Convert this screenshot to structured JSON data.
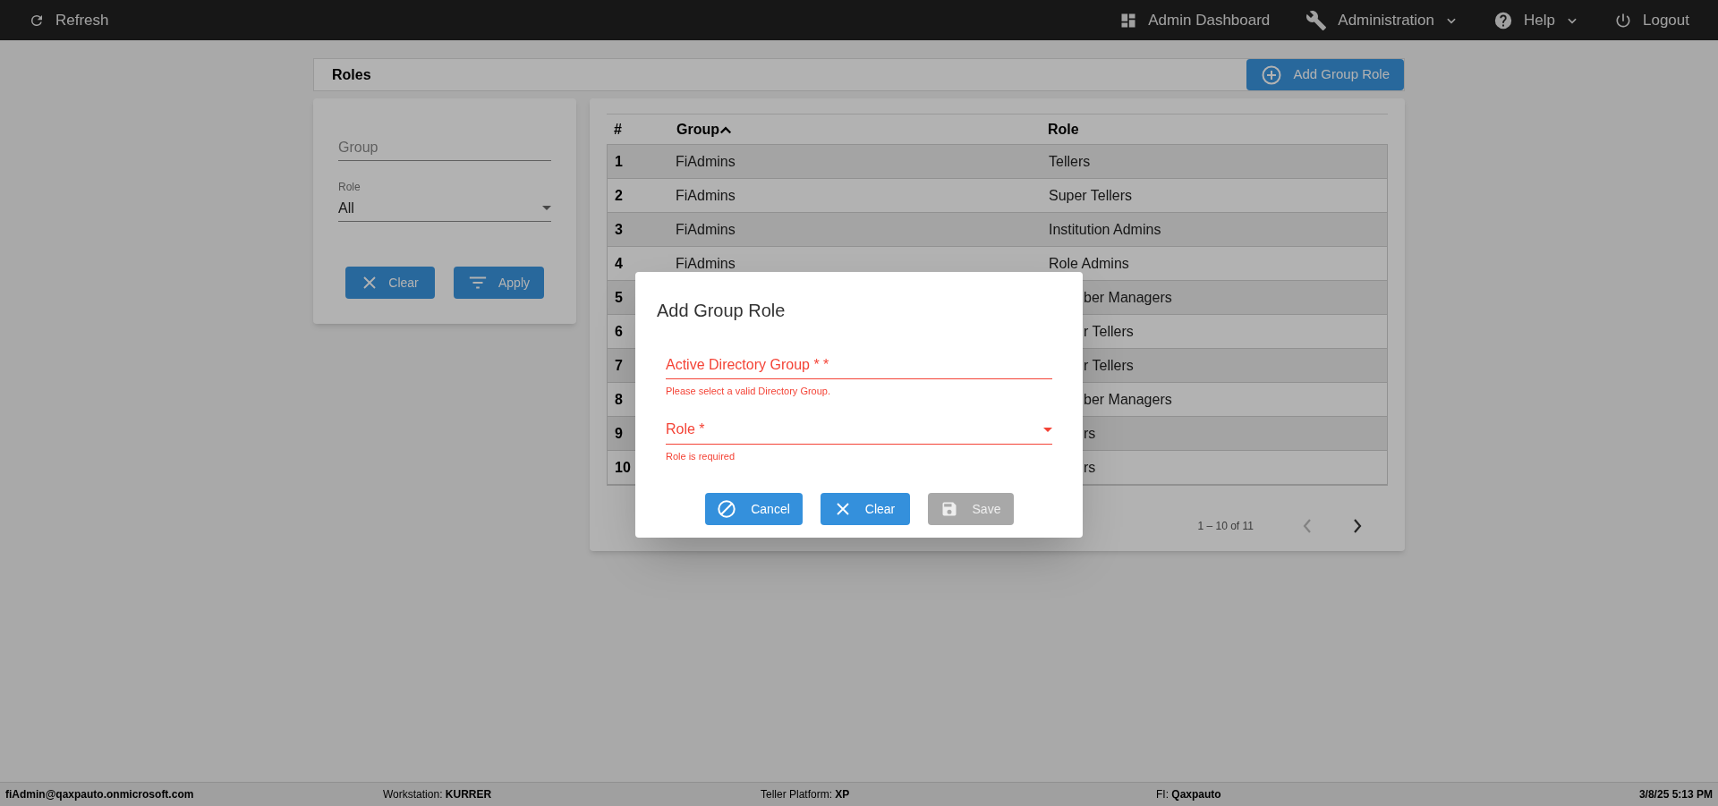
{
  "top_bar": {
    "left": [
      {
        "label": "Refresh"
      }
    ],
    "right": [
      {
        "label": "Admin Dashboard",
        "dropdown": false
      },
      {
        "label": "Administration",
        "dropdown": true
      },
      {
        "label": "Help",
        "dropdown": true
      },
      {
        "label": "Logout",
        "dropdown": false
      }
    ]
  },
  "page": {
    "title": "Roles",
    "add_button": "Add Group Role"
  },
  "filters": {
    "group_placeholder": "Group",
    "role_label": "Role",
    "role_value": "All",
    "buttons": [
      {
        "kind": "clear",
        "label": "Clear"
      },
      {
        "kind": "filter",
        "label": "Apply"
      }
    ]
  },
  "table": {
    "columns": [
      {
        "label": "#",
        "sorted": false
      },
      {
        "label": "Group",
        "sorted": true
      },
      {
        "label": "Role",
        "sorted": false
      }
    ],
    "rows": [
      {
        "number": "1",
        "group": "FiAdmins",
        "role": "Tellers"
      },
      {
        "number": "2",
        "group": "FiAdmins",
        "role": "Super Tellers"
      },
      {
        "number": "3",
        "group": "FiAdmins",
        "role": "Institution Admins"
      },
      {
        "number": "4",
        "group": "FiAdmins",
        "role": "Role Admins"
      },
      {
        "number": "5",
        "role": "ber Managers"
      },
      {
        "number": "6",
        "role": "r Tellers"
      },
      {
        "number": "7",
        "role": "r Tellers"
      },
      {
        "number": "8",
        "role": "ber Managers"
      },
      {
        "number": "9",
        "role": "rs"
      },
      {
        "number": "10",
        "role": "rs"
      }
    ],
    "range": "1 – 10 of 11",
    "prev_disabled": true,
    "next_disabled": false
  },
  "dialog": {
    "title": "Add Group Role",
    "fields": [
      {
        "kind": "text",
        "label": "Active Directory Group * *",
        "error": "Please select a valid Directory Group."
      },
      {
        "kind": "select",
        "label": "Role *",
        "error": "Role is required"
      }
    ],
    "buttons": [
      {
        "kind": "cancel",
        "label": "Cancel",
        "disabled": false
      },
      {
        "kind": "clear",
        "label": "Clear",
        "disabled": false
      },
      {
        "kind": "save",
        "label": "Save",
        "disabled": true
      }
    ]
  },
  "status_bar": [
    {
      "value": "fiAdmin@qaxpauto.onmicrosoft.com"
    },
    {
      "label": "Workstation: ",
      "value": "KURRER"
    },
    {
      "label": "Teller Platform: ",
      "value": "XP"
    },
    {
      "label": "FI: ",
      "value": "Qaxpauto"
    },
    {
      "value": "3/8/25 5:13 PM"
    }
  ]
}
